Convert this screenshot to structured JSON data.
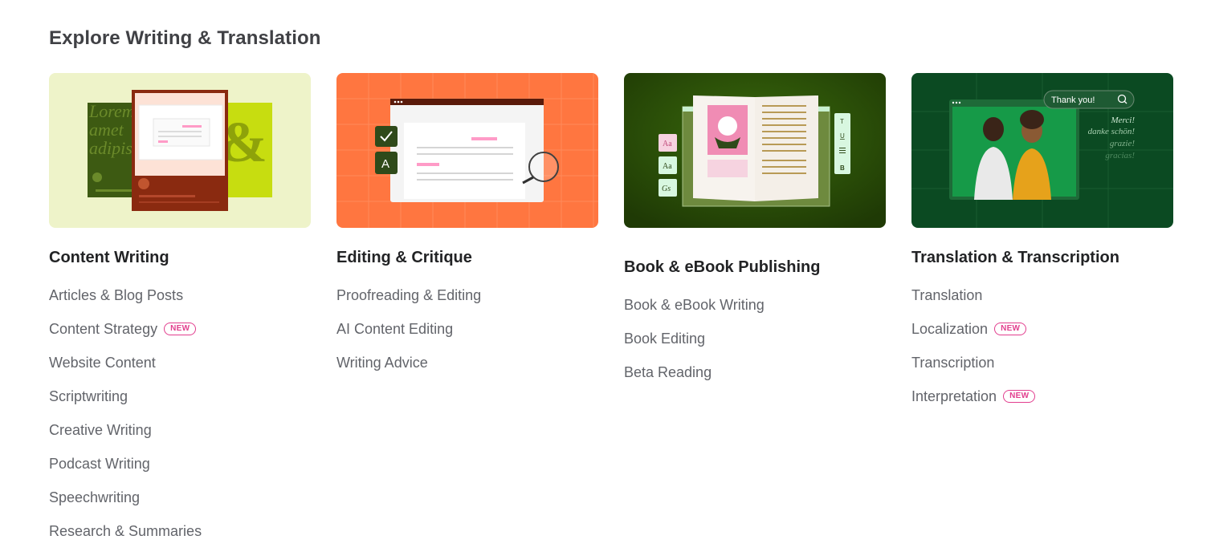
{
  "page": {
    "title": "Explore Writing & Translation"
  },
  "categories": [
    {
      "title": "Content Writing",
      "colors": {
        "background": "#eef3c9"
      },
      "links": [
        {
          "label": "Articles & Blog Posts",
          "badge": ""
        },
        {
          "label": "Content Strategy",
          "badge": "NEW"
        },
        {
          "label": "Website Content",
          "badge": ""
        },
        {
          "label": "Scriptwriting",
          "badge": ""
        },
        {
          "label": "Creative Writing",
          "badge": ""
        },
        {
          "label": "Podcast Writing",
          "badge": ""
        },
        {
          "label": "Speechwriting",
          "badge": ""
        },
        {
          "label": "Research & Summaries",
          "badge": ""
        }
      ]
    },
    {
      "title": "Editing & Critique",
      "colors": {
        "background": "#ff7640"
      },
      "links": [
        {
          "label": "Proofreading & Editing",
          "badge": ""
        },
        {
          "label": "AI Content Editing",
          "badge": ""
        },
        {
          "label": "Writing Advice",
          "badge": ""
        }
      ]
    },
    {
      "title": "Book & eBook Publishing",
      "colors": {
        "background": "#254200"
      },
      "links": [
        {
          "label": "Book & eBook Writing",
          "badge": ""
        },
        {
          "label": "Book Editing",
          "badge": ""
        },
        {
          "label": "Beta Reading",
          "badge": ""
        }
      ]
    },
    {
      "title": "Translation & Transcription",
      "colors": {
        "background": "#0b4a22"
      },
      "links": [
        {
          "label": "Translation",
          "badge": ""
        },
        {
          "label": "Localization",
          "badge": "NEW"
        },
        {
          "label": "Transcription",
          "badge": ""
        },
        {
          "label": "Interpretation",
          "badge": "NEW"
        }
      ]
    }
  ],
  "illustrations": {
    "content_writing": {
      "lorem": "Lorem",
      "amet": "amet",
      "adipis": "adipis",
      "ampersand": "&"
    },
    "book": {
      "aa": "Aa",
      "gs": "Gs",
      "t": "T",
      "u": "U",
      "b": "B"
    },
    "translation": {
      "search_text": "Thank you!",
      "words": [
        "Merci!",
        "danke schön!",
        "grazie!",
        "gracias!"
      ]
    }
  },
  "badge_color": "#e23e8e"
}
